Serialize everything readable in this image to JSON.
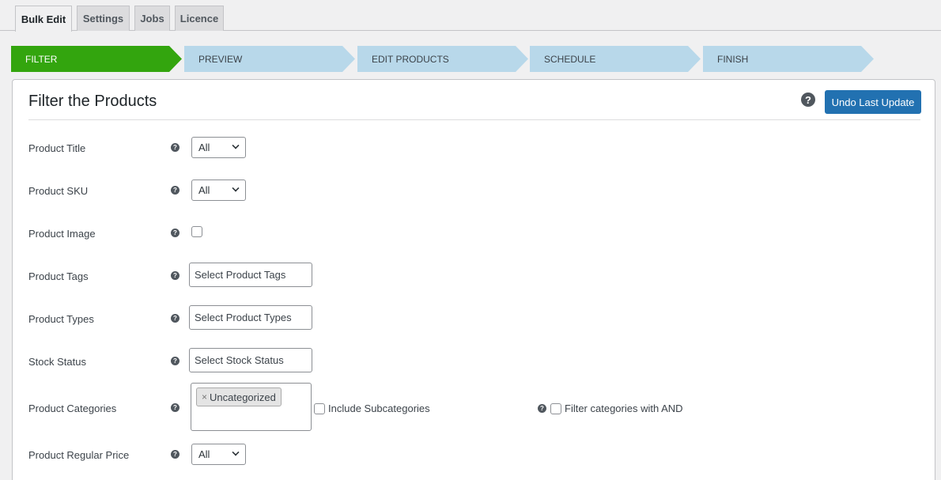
{
  "tabs": [
    {
      "label": "Bulk Edit",
      "active": true
    },
    {
      "label": "Settings",
      "active": false
    },
    {
      "label": "Jobs",
      "active": false
    },
    {
      "label": "Licence",
      "active": false
    }
  ],
  "steps": [
    {
      "label": "FILTER",
      "state": "done"
    },
    {
      "label": "PREVIEW",
      "state": "todo"
    },
    {
      "label": "EDIT PRODUCTS",
      "state": "todo"
    },
    {
      "label": "SCHEDULE",
      "state": "todo"
    },
    {
      "label": "FINISH",
      "state": "todo"
    }
  ],
  "panel": {
    "title": "Filter the Products",
    "help_icon": "?",
    "undo_label": "Undo Last Update"
  },
  "help_glyph": "?",
  "fields": {
    "title": {
      "label": "Product Title",
      "value": "All"
    },
    "sku": {
      "label": "Product SKU",
      "value": "All"
    },
    "image": {
      "label": "Product Image",
      "checked": false
    },
    "tags": {
      "label": "Product Tags",
      "placeholder": "Select Product Tags"
    },
    "types": {
      "label": "Product Types",
      "placeholder": "Select Product Types"
    },
    "stock": {
      "label": "Stock Status",
      "placeholder": "Select Stock Status"
    },
    "categories": {
      "label": "Product Categories",
      "chip": "Uncategorized",
      "chip_remove": "×",
      "include_sub_label": "Include Subcategories",
      "and_label": "Filter categories with AND"
    },
    "regular_price": {
      "label": "Product Regular Price",
      "value": "All"
    }
  },
  "colors": {
    "accent": "#2271b1",
    "step_done": "#33a50e",
    "step_todo": "#b8d8ea"
  }
}
